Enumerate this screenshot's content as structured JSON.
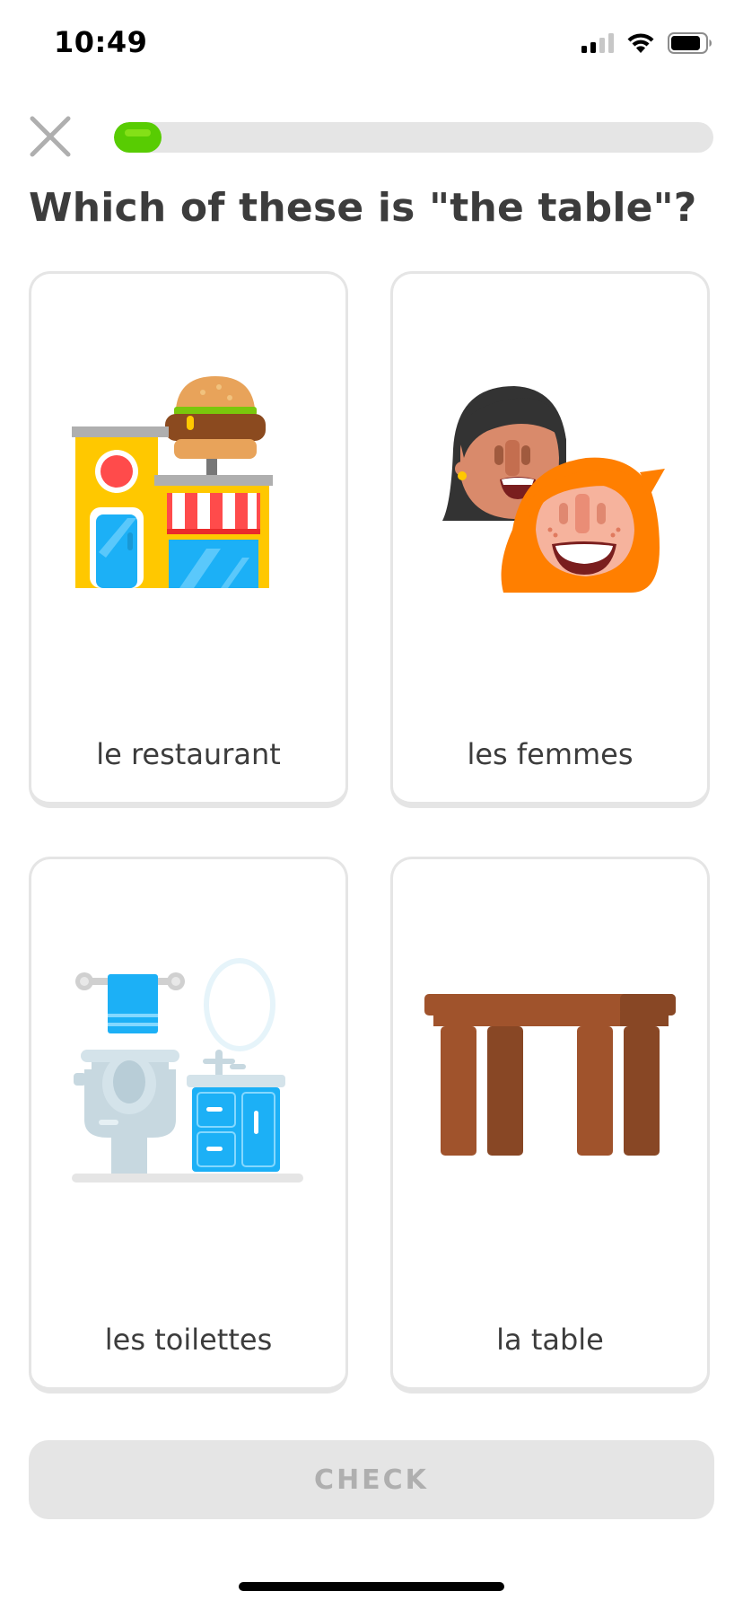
{
  "status_bar": {
    "time": "10:49"
  },
  "header": {
    "close_icon": "close-icon",
    "progress": 0.08
  },
  "prompt": "Which of these is \"the table\"?",
  "options": [
    {
      "label": "le restaurant",
      "icon": "restaurant-icon"
    },
    {
      "label": "les femmes",
      "icon": "women-icon"
    },
    {
      "label": "les toilettes",
      "icon": "toilet-icon"
    },
    {
      "label": "la table",
      "icon": "table-icon"
    }
  ],
  "footer": {
    "check_label": "CHECK"
  },
  "colors": {
    "accent": "#58cc02",
    "border": "#e5e5e5",
    "text": "#3c3c3c",
    "disabled_text": "#afafaf"
  }
}
